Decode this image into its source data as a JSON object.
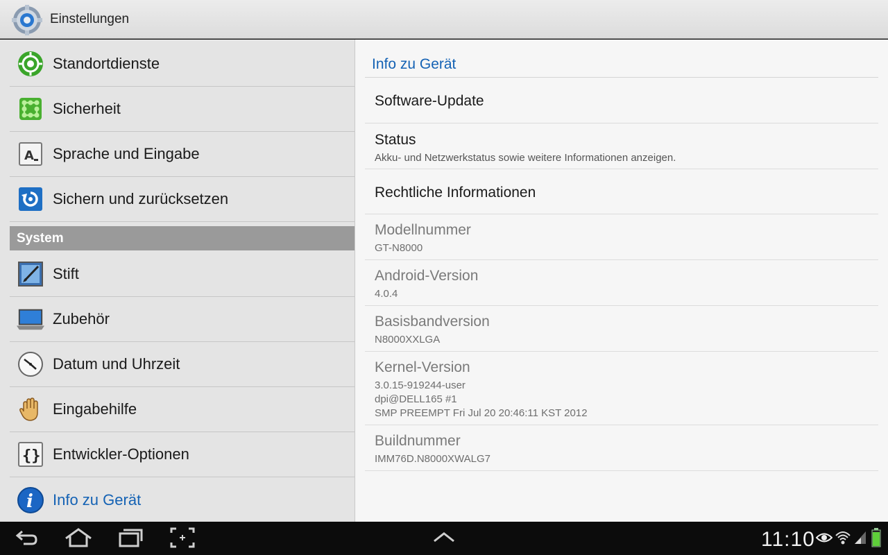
{
  "app": {
    "title": "Einstellungen",
    "icon": "settings-gear-icon"
  },
  "sidebar": {
    "items": [
      {
        "label": "Standortdienste",
        "icon": "location-icon"
      },
      {
        "label": "Sicherheit",
        "icon": "security-pattern-icon"
      },
      {
        "label": "Sprache und Eingabe",
        "icon": "language-keyboard-icon"
      },
      {
        "label": "Sichern und zurücksetzen",
        "icon": "backup-reset-icon"
      },
      {
        "label": "Stift",
        "icon": "pen-icon"
      },
      {
        "label": "Zubehör",
        "icon": "accessory-dock-icon"
      },
      {
        "label": "Datum und Uhrzeit",
        "icon": "clock-icon"
      },
      {
        "label": "Eingabehilfe",
        "icon": "hand-accessibility-icon"
      },
      {
        "label": "Entwickler-Optionen",
        "icon": "developer-braces-icon"
      },
      {
        "label": "Info zu Gerät",
        "icon": "info-icon",
        "active": true
      }
    ],
    "section_system": "System"
  },
  "detail": {
    "header": "Info zu Gerät",
    "rows": [
      {
        "title": "Software-Update",
        "summary": ""
      },
      {
        "title": "Status",
        "summary": "Akku- und Netzwerkstatus sowie weitere Informationen anzeigen."
      },
      {
        "title": "Rechtliche Informationen",
        "summary": ""
      },
      {
        "title": "Modellnummer",
        "summary": "GT-N8000"
      },
      {
        "title": "Android-Version",
        "summary": "4.0.4"
      },
      {
        "title": "Basisbandversion",
        "summary": "N8000XXLGA"
      },
      {
        "title": "Kernel-Version",
        "summary_lines": [
          "3.0.15-919244-user",
          "dpi@DELL165 #1",
          "SMP PREEMPT Fri Jul 20 20:46:11 KST 2012"
        ]
      },
      {
        "title": "Buildnummer",
        "summary": "IMM76D.N8000XWALG7"
      }
    ]
  },
  "navbar": {
    "buttons": [
      "back-icon",
      "home-icon",
      "recent-apps-icon",
      "screenshot-icon",
      "expand-up-icon"
    ],
    "clock": "11:10",
    "status_icons": [
      "eye-icon",
      "wifi-icon",
      "signal-icon",
      "battery-icon"
    ]
  },
  "colors": {
    "accent": "#1462b4",
    "section_bg": "#9a9a9a",
    "navbar_bg": "#0c0c0c"
  }
}
